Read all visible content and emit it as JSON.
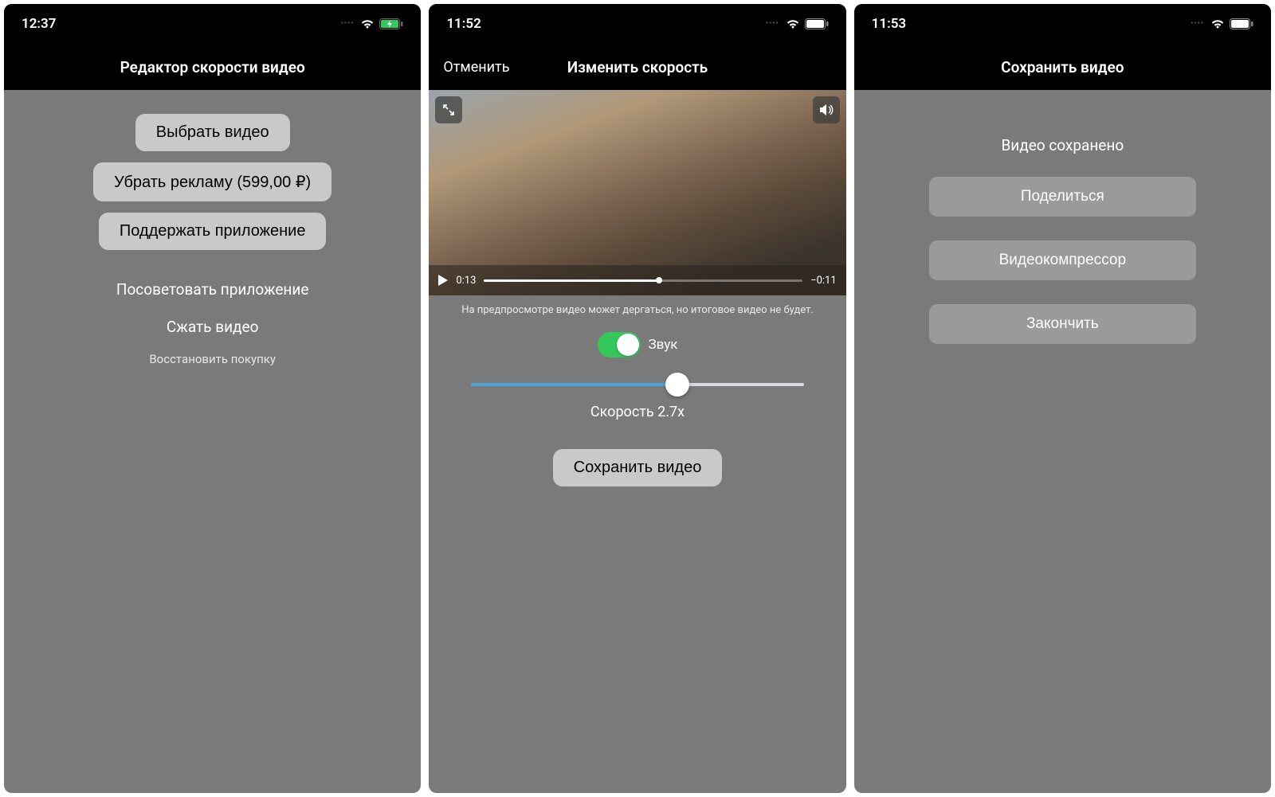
{
  "screen1": {
    "status": {
      "time": "12:37"
    },
    "title": "Редактор скорости видео",
    "buttons": {
      "select_video": "Выбрать видео",
      "remove_ads": "Убрать рекламу (599,00 ₽)",
      "support_app": "Поддержать приложение"
    },
    "links": {
      "recommend": "Посоветовать приложение",
      "compress": "Сжать видео",
      "restore": "Восстановить покупку"
    }
  },
  "screen2": {
    "status": {
      "time": "11:52"
    },
    "nav": {
      "cancel": "Отменить",
      "title": "Изменить скорость"
    },
    "player": {
      "elapsed": "0:13",
      "remaining": "−0:11"
    },
    "hint": "На предпросмотре видео может дергаться, но итоговое видео не будет.",
    "sound_label": "Звук",
    "speed_label": "Скорость 2.7x",
    "save_btn": "Сохранить видео"
  },
  "screen3": {
    "status": {
      "time": "11:53"
    },
    "title": "Сохранить видео",
    "saved_msg": "Видео сохранено",
    "buttons": {
      "share": "Поделиться",
      "compressor": "Видеокомпрессор",
      "finish": "Закончить"
    }
  }
}
